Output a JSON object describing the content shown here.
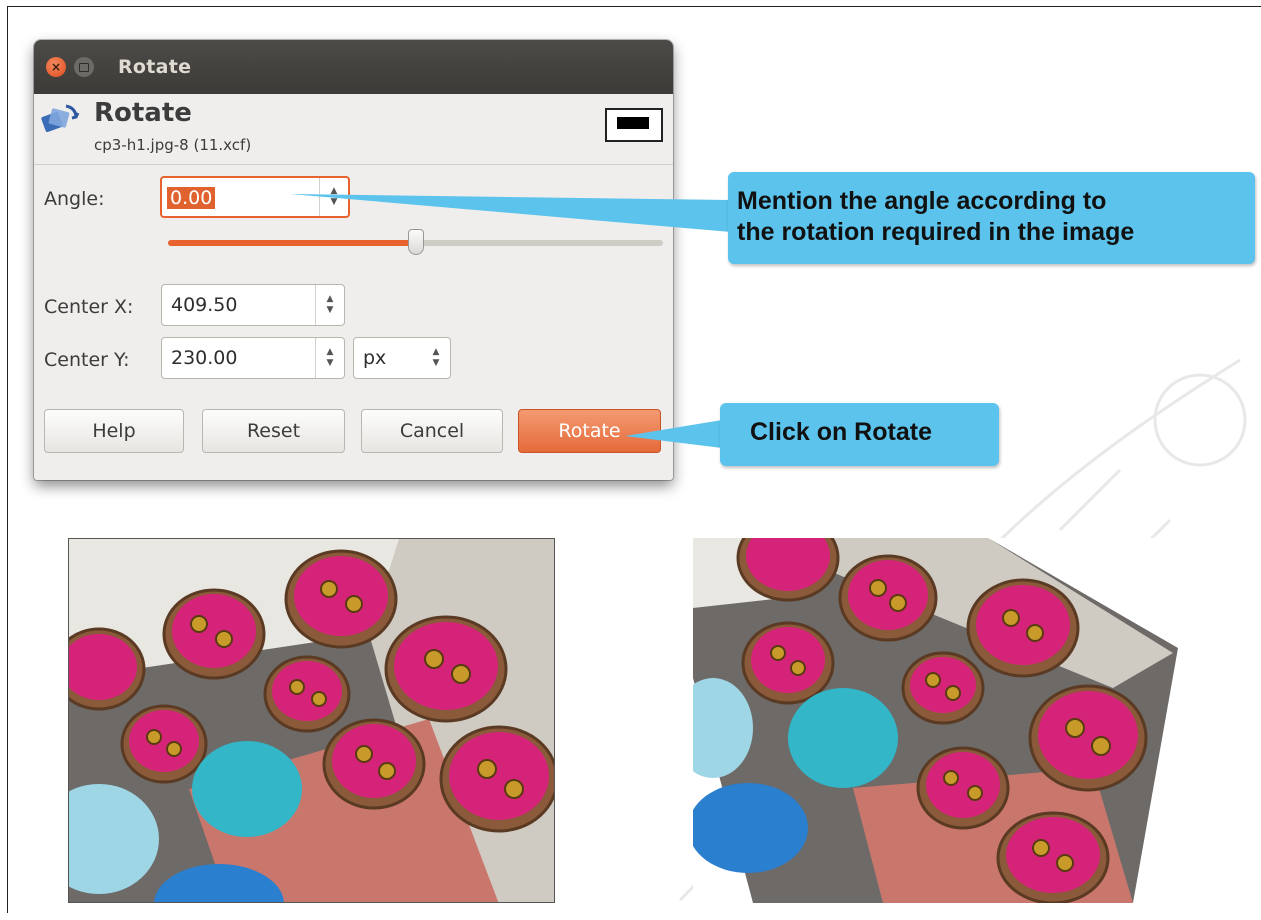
{
  "dialog": {
    "window_title": "Rotate",
    "header_title": "Rotate",
    "header_subtitle": "cp3-h1.jpg-8 (11.xcf)",
    "angle_label": "Angle:",
    "angle_value": "0.00",
    "angle_slider_fraction": 0.5,
    "center_x_label": "Center X:",
    "center_x_value": "409.50",
    "center_y_label": "Center Y:",
    "center_y_value": "230.00",
    "unit_value": "px",
    "buttons": {
      "help": "Help",
      "reset": "Reset",
      "cancel": "Cancel",
      "rotate": "Rotate"
    }
  },
  "callouts": {
    "angle_line1": "Mention the angle according to",
    "angle_line2": "the rotation required in the image",
    "rotate": "Click on Rotate"
  },
  "images": {
    "original": "photo-original",
    "rotated": "photo-rotated"
  },
  "colors": {
    "accent": "#e8622e",
    "callout": "#5bc3ec",
    "titlebar": "#3c3b37"
  }
}
